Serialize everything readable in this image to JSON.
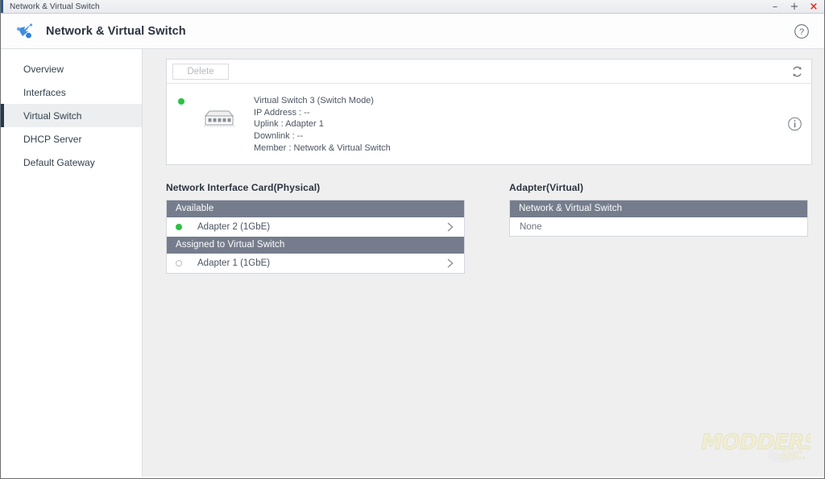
{
  "window": {
    "title": "Network & Virtual Switch",
    "controls": [
      {
        "name": "minimize",
        "glyph": "–"
      },
      {
        "name": "maximize",
        "glyph": "+"
      },
      {
        "name": "close",
        "glyph": "×"
      }
    ],
    "accent_color": "#2a5d8f",
    "close_color": "#d8332a"
  },
  "header": {
    "title": "Network & Virtual Switch",
    "logo_icon": "network-switch-icon",
    "help_icon": "help-circle-icon"
  },
  "sidebar": {
    "items": [
      {
        "label": "Overview",
        "active": false
      },
      {
        "label": "Interfaces",
        "active": false
      },
      {
        "label": "Virtual Switch",
        "active": true
      },
      {
        "label": "DHCP Server",
        "active": false
      },
      {
        "label": "Default Gateway",
        "active": false
      }
    ],
    "active_indicator_color": "#1f3b58",
    "active_background": "#eceef0"
  },
  "switch_card": {
    "toolbar": {
      "delete_label": "Delete",
      "delete_disabled": true,
      "refresh_icon": "refresh-icon"
    },
    "entry": {
      "status": "online",
      "status_color": "#2cc142",
      "icon": "switch-device-icon",
      "name": "Virtual Switch 3 (Switch Mode)",
      "ip_address": "IP Address : --",
      "uplink": "Uplink : Adapter 1",
      "downlink": "Downlink : --",
      "member": "Member : Network & Virtual Switch",
      "info_icon": "info-circle-icon"
    }
  },
  "nic_panel": {
    "title": "Network Interface Card(Physical)",
    "groups": [
      {
        "header": "Available",
        "rows": [
          {
            "label": "Adapter 2 (1GbE)",
            "status": "up",
            "chevron": "chevron-right-icon"
          }
        ]
      },
      {
        "header": "Assigned to Virtual Switch",
        "rows": [
          {
            "label": "Adapter 1 (1GbE)",
            "status": "down",
            "chevron": "chevron-right-icon"
          }
        ]
      }
    ],
    "header_color": "#757d8d"
  },
  "adapter_panel": {
    "title": "Adapter(Virtual)",
    "group_header": "Network & Virtual Switch",
    "empty_label": "None",
    "header_color": "#757d8d"
  },
  "watermark": {
    "text": "MODDERS",
    "subtext": "INC."
  }
}
